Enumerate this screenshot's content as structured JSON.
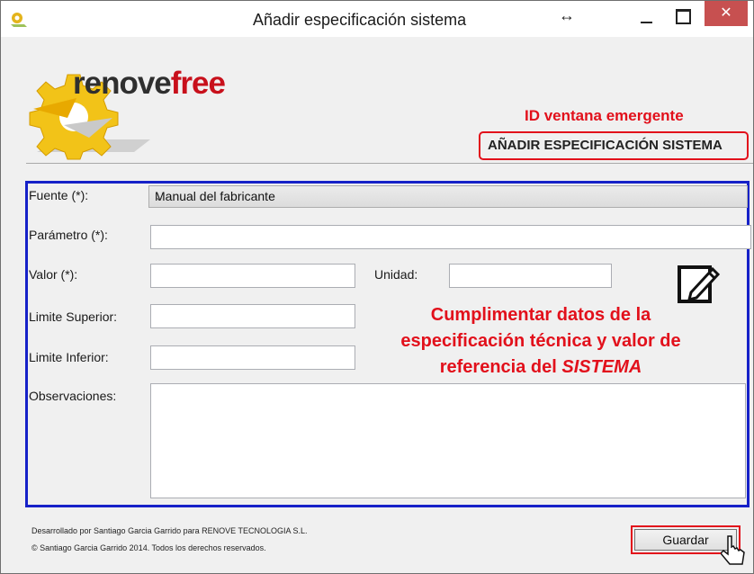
{
  "window": {
    "title": "Añadir especificación sistema",
    "close_label": "✕",
    "move_glyph": "↔"
  },
  "logo": {
    "part1": "renove",
    "part2": "free"
  },
  "annotations": {
    "id_label": "ID  ventana emergente",
    "window_id": "AÑADIR ESPECIFICACIÓN SISTEMA",
    "instruction_line1": "Cumplimentar datos de la",
    "instruction_line2": "especificación técnica y valor de",
    "instruction_line3_prefix": "referencia del ",
    "instruction_line3_emph": "SISTEMA"
  },
  "form": {
    "source_label": "Fuente (*):",
    "source_value": "Manual del fabricante",
    "parameter_label": "Parámetro (*):",
    "parameter_value": "",
    "value_label": "Valor (*):",
    "value_value": "",
    "unit_label": "Unidad:",
    "unit_value": "",
    "upper_label": "Limite Superior:",
    "upper_value": "",
    "lower_label": "Limite Inferior:",
    "lower_value": "",
    "notes_label": "Observaciones:",
    "notes_value": ""
  },
  "footer": {
    "credit": "Desarrollado por Santiago Garcia Garrido para RENOVE TECNOLOGIA S.L.",
    "copyright": "© Santiago Garcia Garrido 2014. Todos los derechos reservados."
  },
  "buttons": {
    "save": "Guardar"
  },
  "colors": {
    "annotation_red": "#e2101b",
    "form_frame_blue": "#1621c8",
    "close_red": "#c75050"
  },
  "icons": [
    "app-icon",
    "move-icon",
    "minimize-icon",
    "maximize-icon",
    "close-icon",
    "chevron-down-icon",
    "edit-pencil-icon",
    "mouse-cursor-icon"
  ]
}
